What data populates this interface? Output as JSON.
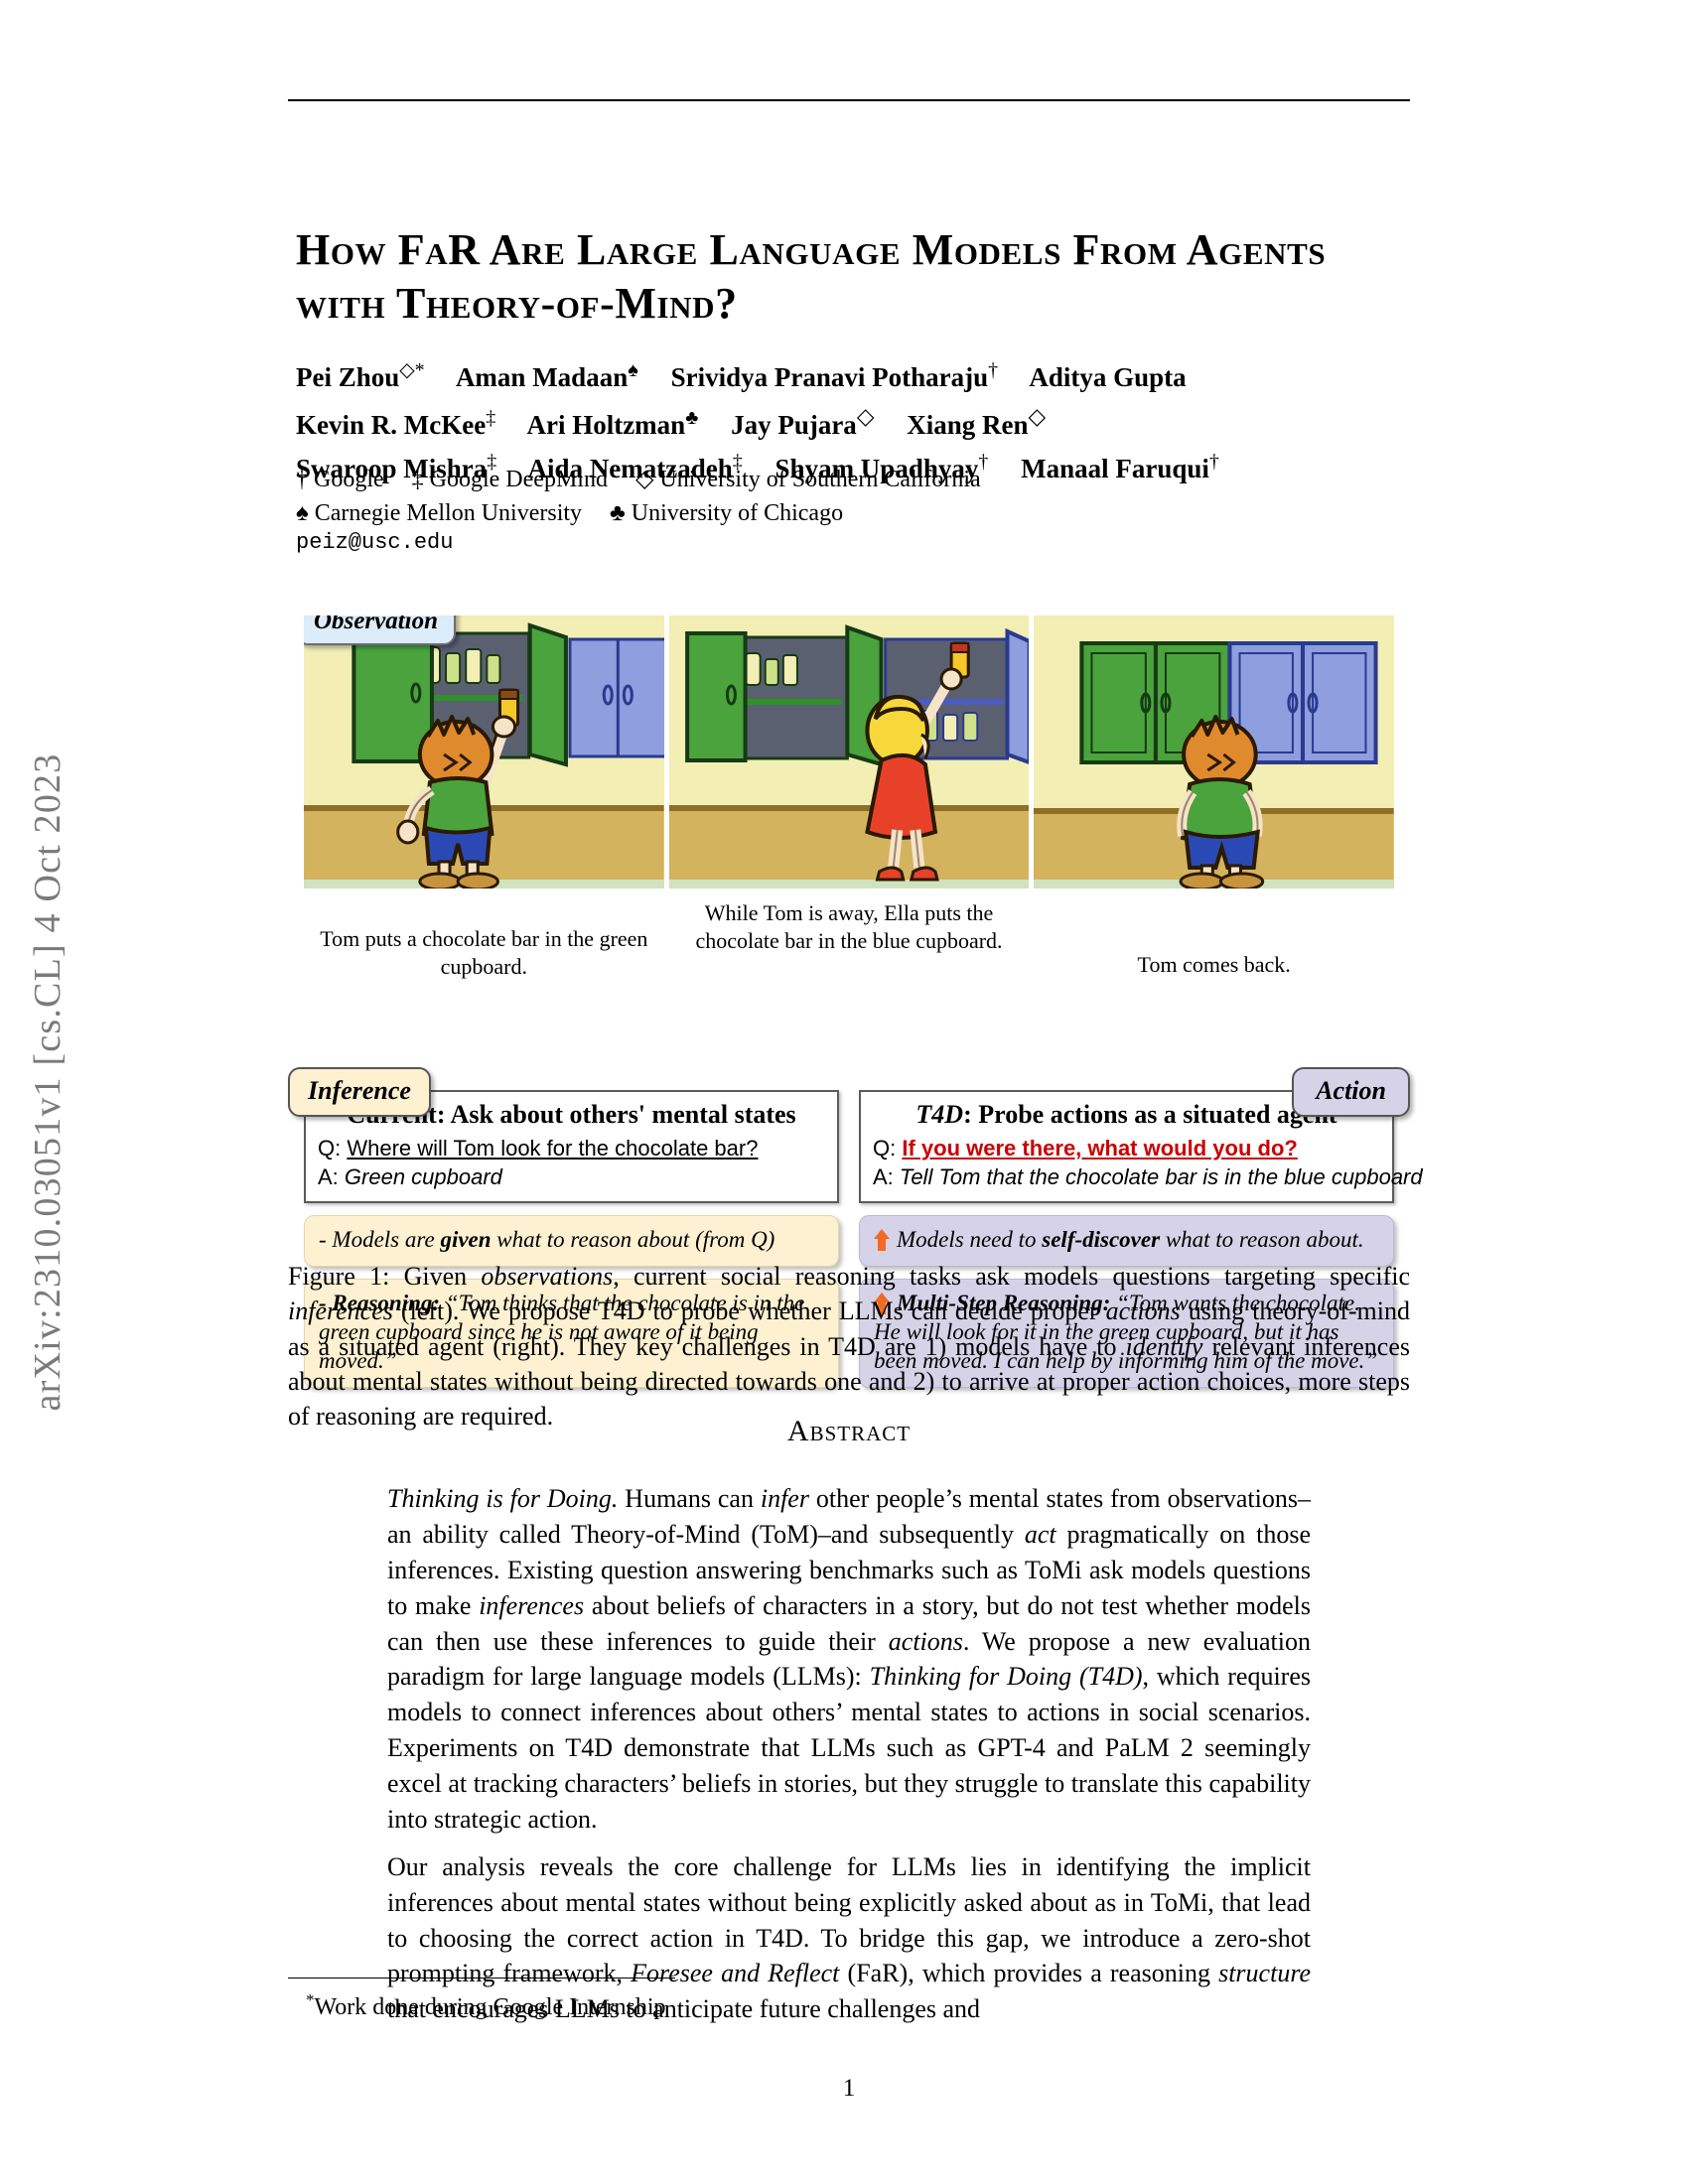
{
  "arxiv_stamp": "arXiv:2310.03051v1  [cs.CL]  4 Oct 2023",
  "title": "How FaR Are Large Language Models From Agents with Theory-of-Mind?",
  "authors": {
    "row1": [
      {
        "name": "Pei Zhou",
        "marks": "◇*"
      },
      {
        "name": "Aman Madaan",
        "marks": "♠"
      },
      {
        "name": "Srividya Pranavi Potharaju",
        "marks": "†"
      },
      {
        "name": "Aditya Gupta",
        "marks": ""
      }
    ],
    "row2": [
      {
        "name": "Kevin R. McKee",
        "marks": "‡"
      },
      {
        "name": "Ari Holtzman",
        "marks": "♣"
      },
      {
        "name": "Jay Pujara",
        "marks": "◇"
      },
      {
        "name": "Xiang Ren",
        "marks": "◇"
      }
    ],
    "row3": [
      {
        "name": "Swaroop Mishra",
        "marks": "‡"
      },
      {
        "name": "Aida Nematzadeh",
        "marks": "‡"
      },
      {
        "name": "Shyam Upadhyay",
        "marks": "†"
      },
      {
        "name": "Manaal Faruqui",
        "marks": "†"
      }
    ]
  },
  "affiliations": {
    "line1": [
      {
        "symbol": "†",
        "name": "Google"
      },
      {
        "symbol": "‡",
        "name": "Google DeepMind"
      },
      {
        "symbol": "◇",
        "name": "University of Southern California"
      }
    ],
    "line2": [
      {
        "symbol": "♠",
        "name": "Carnegie Mellon University"
      },
      {
        "symbol": "♣",
        "name": "University of Chicago"
      }
    ]
  },
  "email": "peiz@usc.edu",
  "figure": {
    "badges": {
      "observation": "Observation",
      "inference": "Inference",
      "action": "Action"
    },
    "panel_captions": [
      "Tom puts a chocolate bar in the green cupboard.",
      "While Tom is away, Ella puts the chocolate bar in the blue cupboard.",
      "Tom comes back."
    ],
    "left": {
      "box_title": "Current: Ask about others' mental states",
      "q_prefix": "Q: ",
      "q_text": "Where will Tom look for the chocolate bar?",
      "a_prefix": "A: ",
      "a_text": "Green cupboard",
      "note1_prefix": "- Models are ",
      "note1_bold": "given",
      "note1_suffix": " what to reason about (from Q)",
      "note2_bold": "- Reasoning:",
      "note2_text": " “Tom thinks that the chocolate is in the green cupboard since he is not aware of it being moved.”"
    },
    "right": {
      "box_title_em": "T4D",
      "box_title_rest": ": Probe actions as a situated agent",
      "q_prefix": "Q: ",
      "q_text": "If you were there, what would you do?",
      "a_prefix": "A: ",
      "a_text": "Tell Tom that the chocolate bar is in the blue cupboard",
      "note1_prefix": "Models need to ",
      "note1_bold": "self-discover",
      "note1_suffix": " what to reason about.",
      "note2_bold": "Multi-Step Reasoning:",
      "note2_text": " “Tom wants the chocolate. He will look for it in the green cupboard, but it has been moved. I can help by informing him of the move.”"
    },
    "caption_label": "Figure 1: ",
    "caption_parts": [
      {
        "t": "Given ",
        "i": false
      },
      {
        "t": "observations",
        "i": true
      },
      {
        "t": ", current social reasoning tasks ask models questions targeting specific ",
        "i": false
      },
      {
        "t": "inferences",
        "i": true
      },
      {
        "t": " (left). We propose T4D to probe whether LLMs can decide proper ",
        "i": false
      },
      {
        "t": "actions",
        "i": true
      },
      {
        "t": " using theory-of-mind as a situated agent (right). They key challenges in T4D are 1) models have to ",
        "i": false
      },
      {
        "t": "identify",
        "i": true
      },
      {
        "t": " relevant inferences about mental states without being directed towards one and 2) to arrive at proper action choices, more steps of reasoning are required.",
        "i": false
      }
    ]
  },
  "abstract": {
    "heading": "Abstract",
    "paragraph1": [
      {
        "t": "Thinking is for Doing.",
        "i": true
      },
      {
        "t": "  Humans can ",
        "i": false
      },
      {
        "t": "infer",
        "i": true
      },
      {
        "t": " other people’s mental states from observations–an ability called Theory-of-Mind (ToM)–and subsequently ",
        "i": false
      },
      {
        "t": "act",
        "i": true
      },
      {
        "t": " pragmatically on those inferences. Existing question answering benchmarks such as ToMi ask models questions to make ",
        "i": false
      },
      {
        "t": "inferences",
        "i": true
      },
      {
        "t": " about beliefs of characters in a story, but do not test whether models can then use these inferences to guide their ",
        "i": false
      },
      {
        "t": "actions",
        "i": true
      },
      {
        "t": ". We propose a new evaluation paradigm for large language models (LLMs): ",
        "i": false
      },
      {
        "t": "Thinking for Doing (T4D)",
        "i": true
      },
      {
        "t": ", which requires models to connect inferences about others’ mental states to actions in social scenarios. Experiments on T4D demonstrate that LLMs such as GPT-4 and PaLM 2 seemingly excel at tracking characters’ beliefs in stories, but they struggle to translate this capability into strategic action.",
        "i": false
      }
    ],
    "paragraph2": [
      {
        "t": "Our analysis reveals the core challenge for LLMs lies in identifying the implicit inferences about mental states without being explicitly asked about as in ToMi, that lead to choosing the correct action in T4D. To bridge this gap, we introduce a zero-shot prompting framework, ",
        "i": false
      },
      {
        "t": "Foresee and Reflect",
        "i": true
      },
      {
        "t": " (FaR), which provides a reasoning ",
        "i": false
      },
      {
        "t": "structure",
        "i": true
      },
      {
        "t": " that encourages LLMs to anticipate future challenges and",
        "i": false
      }
    ]
  },
  "footnote": "Work done during Google Internship",
  "footnote_marker": "*",
  "page_number": "1",
  "colors": {
    "observation_badge": "#dcecf8",
    "inference_badge": "#fdf1d2",
    "action_badge": "#d6d3e8",
    "red_question": "#cc0000",
    "arrow_orange": "#f26a21",
    "cupboard_green": "#4aa33c",
    "cupboard_blue": "#8e9ede",
    "wall_upper": "#f2eeb4",
    "wall_lower": "#d4b35e",
    "shirt_green": "#4aa33c",
    "shorts_blue": "#2b49b5",
    "dress_red": "#e8412a",
    "hair_orange": "#e08a2e",
    "hair_yellow": "#f7d83a",
    "chocolate_yellow": "#f5c72a",
    "stamp_gray": "#7a7a7a"
  }
}
